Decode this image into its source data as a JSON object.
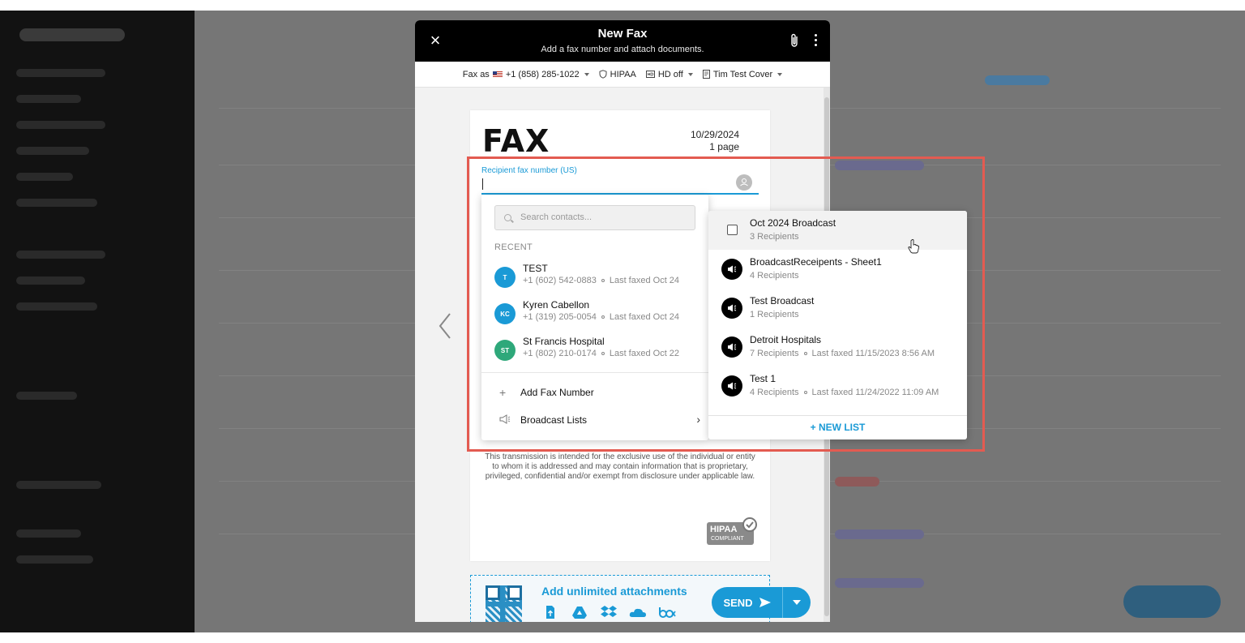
{
  "modal": {
    "title": "New Fax",
    "subtitle": "Add a fax number and attach documents."
  },
  "settings": {
    "fax_as_label": "Fax as",
    "fax_as_number": "+1 (858) 285-1022",
    "hipaa": "HIPAA",
    "hd": "HD off",
    "cover": "Tim Test Cover"
  },
  "fax_page": {
    "heading": "FAX",
    "date": "10/29/2024",
    "pages": "1 page",
    "recipient_label": "Recipient fax number (US)",
    "legal_text": "This transmission is intended for the exclusive use of the individual or entity to whom it is addressed and may contain information that is proprietary, privileged, confidential and/or exempt from disclosure under applicable law.",
    "hipaa_badge_1": "HIPAA",
    "hipaa_badge_2": "COMPLIANT"
  },
  "contacts_dropdown": {
    "search_placeholder": "Search contacts...",
    "recent_label": "RECENT",
    "recent": [
      {
        "initials": "T",
        "name": "TEST",
        "number": "+1 (602) 542-0883",
        "last": "Last faxed Oct 24",
        "color": "#1a9ad6"
      },
      {
        "initials": "KC",
        "name": "Kyren Cabellon",
        "number": "+1 (319) 205-0054",
        "last": "Last faxed Oct 24",
        "color": "#1a9ad6"
      },
      {
        "initials": "ST",
        "name": "St Francis Hospital",
        "number": "+1 (802) 210-0174",
        "last": "Last faxed Oct 22",
        "color": "#2ea87a"
      }
    ],
    "add_fax_number": "Add Fax Number",
    "broadcast_lists": "Broadcast Lists"
  },
  "broadcast_lists": {
    "items": [
      {
        "name": "Oct 2024 Broadcast",
        "meta": "3 Recipients",
        "last": ""
      },
      {
        "name": "BroadcastReceipents - Sheet1",
        "meta": "4 Recipients",
        "last": ""
      },
      {
        "name": "Test Broadcast",
        "meta": "1 Recipients",
        "last": ""
      },
      {
        "name": "Detroit Hospitals",
        "meta": "7 Recipients",
        "last": "Last faxed 11/15/2023 8:56 AM"
      },
      {
        "name": "Test 1",
        "meta": "4 Recipients",
        "last": "Last faxed 11/24/2022 11:09 AM"
      }
    ],
    "new_list": "+ NEW LIST"
  },
  "attachments": {
    "title": "Add unlimited attachments"
  },
  "send": {
    "label": "SEND"
  },
  "colors": {
    "accent": "#1a9ad6",
    "highlight": "#e35b51"
  }
}
